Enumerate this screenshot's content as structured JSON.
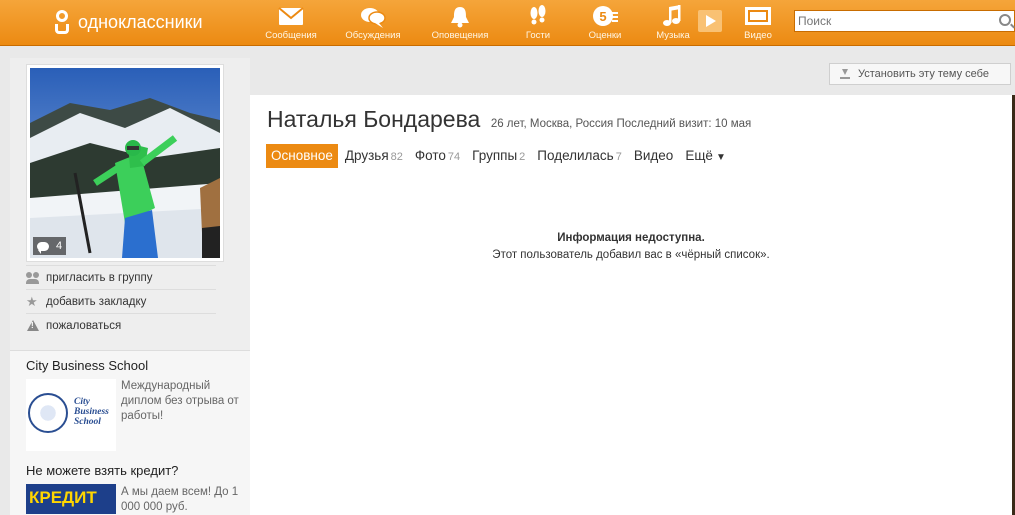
{
  "header": {
    "logo_text": "одноклассники",
    "nav": [
      {
        "label": "Сообщения",
        "icon": "envelope-icon"
      },
      {
        "label": "Обсуждения",
        "icon": "speech-bubbles-icon"
      },
      {
        "label": "Оповещения",
        "icon": "bell-icon"
      },
      {
        "label": "Гости",
        "icon": "footprints-icon"
      },
      {
        "label": "Оценки",
        "icon": "rating-icon"
      },
      {
        "label": "Музыка",
        "icon": "music-note-icon"
      },
      {
        "label": "Видео",
        "icon": "video-icon"
      }
    ],
    "search_placeholder": "Поиск"
  },
  "theme_button": "Установить эту тему себе",
  "profile": {
    "name": "Наталья Бондарева",
    "meta": "26 лет, Москва, Россия  Последний визит: 10 мая",
    "photo_comments": "4",
    "actions": [
      {
        "label": "пригласить в группу",
        "icon": "people-icon"
      },
      {
        "label": "добавить закладку",
        "icon": "star-icon"
      },
      {
        "label": "пожаловаться",
        "icon": "warning-icon"
      }
    ],
    "tabs": [
      {
        "label": "Основное",
        "count": ""
      },
      {
        "label": "Друзья",
        "count": "82"
      },
      {
        "label": "Фото",
        "count": "74"
      },
      {
        "label": "Группы",
        "count": "2"
      },
      {
        "label": "Поделилась",
        "count": "7"
      },
      {
        "label": "Видео",
        "count": ""
      },
      {
        "label": "Ещё",
        "count": ""
      }
    ],
    "info_title": "Информация недоступна.",
    "info_text": "Этот пользователь добавил вас в «чёрный список»."
  },
  "ads": [
    {
      "title": "City Business School",
      "text": "Международный диплом без отрыва от работы!",
      "logo_text": [
        "City",
        "Business",
        "School"
      ]
    },
    {
      "title": "Не можете взять кредит?",
      "text": "А мы даем всем! До 1 000 000 руб.",
      "logo_text": "КРЕДИТ"
    }
  ],
  "colors": {
    "accent": "#ec8a12",
    "brand_bar": "#f5a53a"
  }
}
